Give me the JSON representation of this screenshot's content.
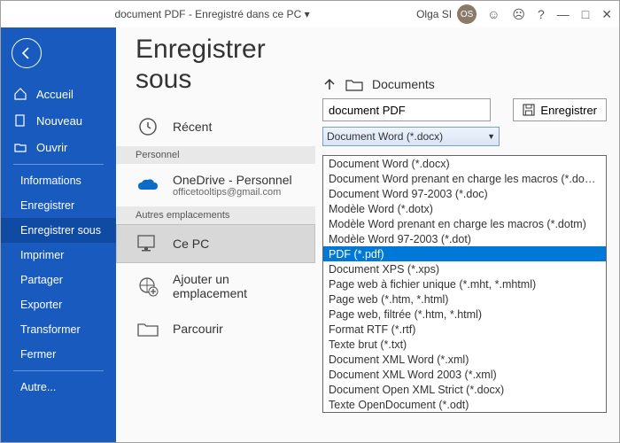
{
  "titlebar": {
    "doc_name": "document PDF",
    "save_state": "Enregistré dans ce PC",
    "user_name": "Olga SI",
    "user_initials": "OS"
  },
  "sidebar": {
    "accueil": "Accueil",
    "nouveau": "Nouveau",
    "ouvrir": "Ouvrir",
    "items": [
      "Informations",
      "Enregistrer",
      "Enregistrer sous",
      "Imprimer",
      "Partager",
      "Exporter",
      "Transformer",
      "Fermer",
      "Autre..."
    ]
  },
  "page": {
    "title": "Enregistrer sous",
    "recent": "Récent",
    "section_personal": "Personnel",
    "onedrive": "OneDrive - Personnel",
    "onedrive_email": "officetooltips@gmail.com",
    "section_other": "Autres emplacements",
    "this_pc": "Ce PC",
    "add_place": "Ajouter un emplacement",
    "browse": "Parcourir"
  },
  "right": {
    "folder": "Documents",
    "filename": "document PDF",
    "type_selected": "Document Word (*.docx)",
    "save_label": "Enregistrer",
    "types": [
      "Document Word (*.docx)",
      "Document Word prenant en charge les macros (*.docm)",
      "Document Word 97-2003 (*.doc)",
      "Modèle Word (*.dotx)",
      "Modèle Word prenant en charge les macros (*.dotm)",
      "Modèle Word 97-2003 (*.dot)",
      "PDF (*.pdf)",
      "Document XPS (*.xps)",
      "Page web à fichier unique (*.mht, *.mhtml)",
      "Page web (*.htm, *.html)",
      "Page web, filtrée (*.htm, *.html)",
      "Format RTF (*.rtf)",
      "Texte brut (*.txt)",
      "Document XML Word (*.xml)",
      "Document XML Word 2003 (*.xml)",
      "Document Open XML Strict (*.docx)",
      "Texte OpenDocument (*.odt)"
    ],
    "type_highlight_index": 6
  }
}
